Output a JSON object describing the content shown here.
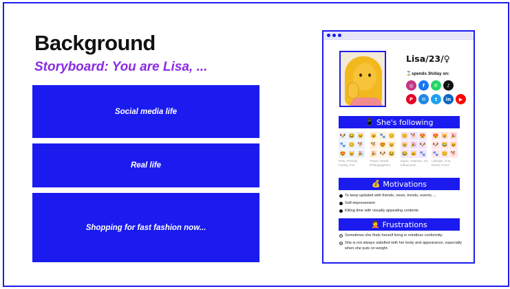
{
  "slide": {
    "title": "Background",
    "subtitle": "Storyboard: You are Lisa, ...",
    "boxes": [
      {
        "label": "Social media life"
      },
      {
        "label": "Real life"
      },
      {
        "label": "Shopping for fast fashion now..."
      }
    ]
  },
  "persona": {
    "name": "Lisa/23/♀",
    "spends": "⌛spends 3h/day on:",
    "social": [
      {
        "icon": "instagram-icon",
        "glyph": "◎",
        "color": "#c13584"
      },
      {
        "icon": "facebook-icon",
        "glyph": "f",
        "color": "#1877f2"
      },
      {
        "icon": "whatsapp-icon",
        "glyph": "✆",
        "color": "#25d366"
      },
      {
        "icon": "tiktok-icon",
        "glyph": "♪",
        "color": "#111111"
      },
      {
        "icon": "pinterest-icon",
        "glyph": "P",
        "color": "#e60023"
      },
      {
        "icon": "messenger-icon",
        "glyph": "✉",
        "color": "#1e88e5"
      },
      {
        "icon": "twitter-icon",
        "glyph": "t",
        "color": "#1da1f2"
      },
      {
        "icon": "linkedin-icon",
        "glyph": "in",
        "color": "#0a66c2"
      },
      {
        "icon": "youtube-icon",
        "glyph": "▶",
        "color": "#ff0000"
      }
    ],
    "following": {
      "title": "She's following",
      "icon": "📱",
      "groups": [
        {
          "caption": "Pets, Friends, Family, Fun",
          "bg": "#eaf2ff"
        },
        {
          "caption": "Travel, World, Photographers",
          "bg": "#fff3e0"
        },
        {
          "caption": "Music, Fashion, Art, Influencers",
          "bg": "#f1e4ff"
        },
        {
          "caption": "Lifestyle, Fun, Event, Food",
          "bg": "#ffe6ee"
        }
      ]
    },
    "motivations": {
      "title": "Motivations",
      "icon": "💰",
      "items": [
        "To keep updated with friends, news, trends, events, ...",
        "Self-improvement",
        "Killing time with visually appealing contents"
      ]
    },
    "frustrations": {
      "title": "Frustrations",
      "icon": "🤦",
      "items": [
        "Sometimes she finds herself living in mindless conformity.",
        "She is not always satisfied with her body and appearance, especially when she puts on weight."
      ]
    }
  },
  "colors": {
    "accent": "#1b1bef",
    "subtitle": "#8a2be2"
  }
}
